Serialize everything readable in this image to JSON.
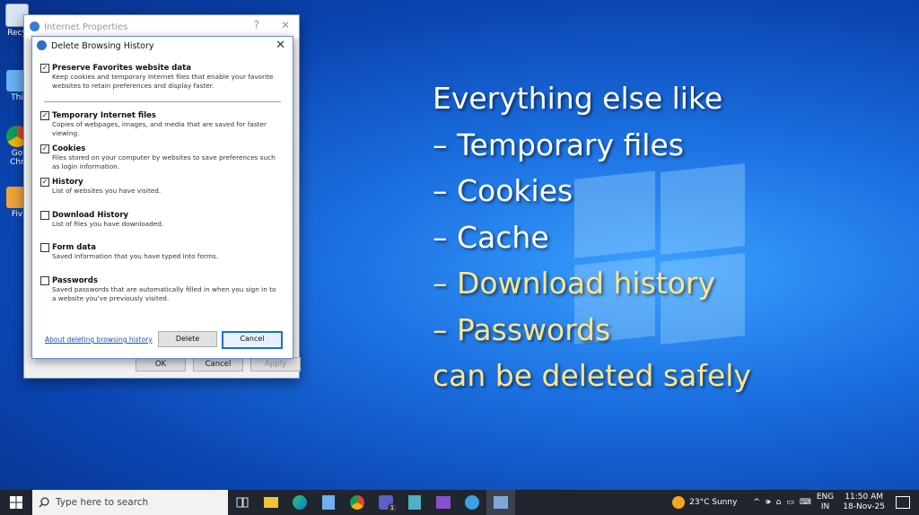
{
  "desktop": {
    "icon_labels": [
      "Recy",
      "Thi",
      "Go\nChr",
      "Fiv"
    ]
  },
  "internet_properties": {
    "title": "Internet Properties",
    "help_glyph": "?",
    "close_glyph": "✕",
    "buttons": {
      "ok": "OK",
      "cancel": "Cancel",
      "apply": "Apply"
    }
  },
  "delete_history_dialog": {
    "title": "Delete Browsing History",
    "items": [
      {
        "label": "Preserve Favorites website data",
        "checked": true,
        "desc": "Keep cookies and temporary Internet files that enable your favorite websites to retain preferences and display faster."
      },
      {
        "label": "Temporary Internet files",
        "checked": true,
        "desc": "Copies of webpages, images, and media that are saved for faster viewing."
      },
      {
        "label": "Cookies",
        "checked": true,
        "desc": "Files stored on your computer by websites to save preferences such as login information."
      },
      {
        "label": "History",
        "checked": true,
        "desc": "List of websites you have visited."
      },
      {
        "label": "Download History",
        "checked": false,
        "desc": "List of files you have downloaded."
      },
      {
        "label": "Form data",
        "checked": false,
        "desc": "Saved information that you have typed into forms."
      },
      {
        "label": "Passwords",
        "checked": false,
        "desc": "Saved passwords that are automatically filled in when you sign in to a website you've previously visited."
      }
    ],
    "link": "About deleting browsing history",
    "delete_label": "Delete",
    "cancel_label": "Cancel"
  },
  "overlay": {
    "lines": [
      {
        "text": "Everything else like",
        "color": "white"
      },
      {
        "text": "– Temporary files",
        "color": "white"
      },
      {
        "text": "– Cookies",
        "color": "white"
      },
      {
        "text": "– Cache",
        "color": "white"
      },
      {
        "text": "– Download history",
        "color": "yellow"
      },
      {
        "text": "– Passwords",
        "color": "yellow"
      },
      {
        "text": "can be deleted safely",
        "color": "yellow"
      }
    ]
  },
  "taskbar": {
    "search_placeholder": "Type here to search",
    "weather": "23°C  Sunny",
    "language": "ENG",
    "region": "IN",
    "time": "11:50 AM",
    "date": "18-Nov-25",
    "badge_count": "1"
  },
  "colors": {
    "accent": "#1a6dd6",
    "overlay_white": "#ffffff",
    "overlay_yellow": "#ffe68a",
    "taskbar": "#20252e"
  }
}
